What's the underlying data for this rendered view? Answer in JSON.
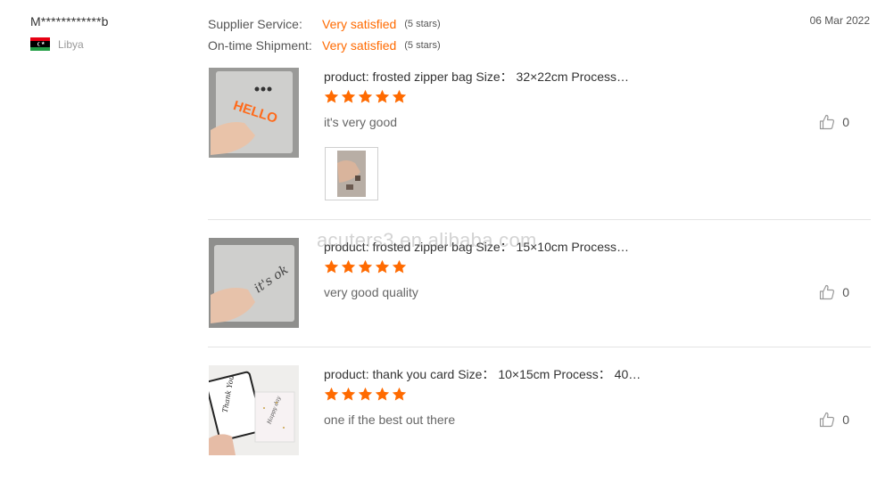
{
  "reviewer": {
    "name": "M************b",
    "country": "Libya",
    "flag_icon": "libya-flag-icon"
  },
  "ratings": [
    {
      "label": "Supplier Service:",
      "value": "Very satisfied",
      "stars": "(5 stars)"
    },
    {
      "label": "On-time Shipment:",
      "value": "Very satisfied",
      "stars": "(5 stars)"
    }
  ],
  "date": "06 Mar 2022",
  "reviews": [
    {
      "product": "product: frosted zipper bag Size： 32×22cm Process…",
      "rating": 5,
      "comment": "it's very good",
      "likes": "0",
      "has_attachment": true
    },
    {
      "product": "product: frosted zipper bag Size： 15×10cm Process…",
      "rating": 5,
      "comment": "very good quality",
      "likes": "0",
      "has_attachment": false
    },
    {
      "product": "product: thank you card Size： 10×15cm Process： 40…",
      "rating": 5,
      "comment": "one if the best out there",
      "likes": "0",
      "has_attachment": false
    }
  ],
  "watermark": "acuters3.en.alibaba.com",
  "colors": {
    "accent": "#ff6a00",
    "divider": "#e4e4e4"
  }
}
